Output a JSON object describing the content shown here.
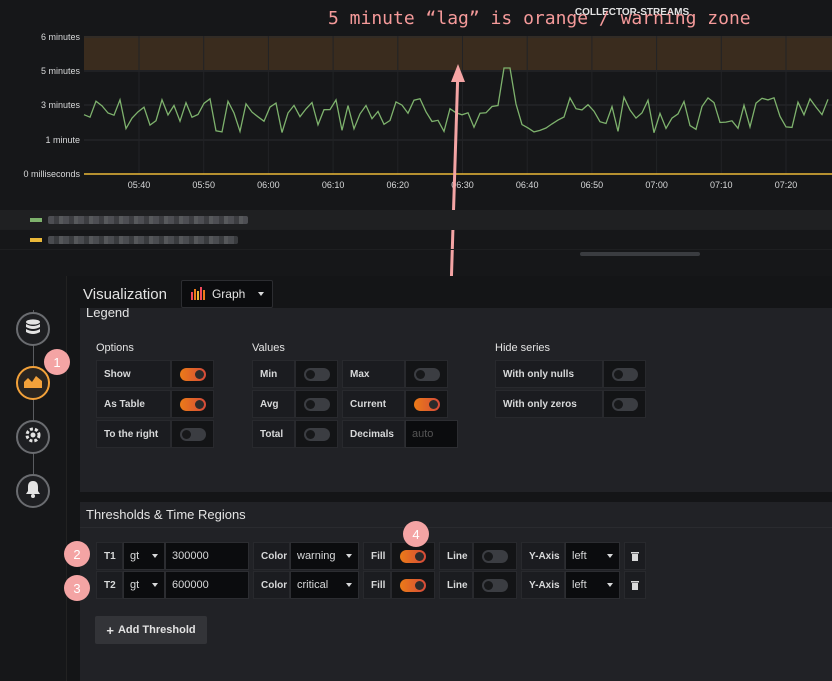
{
  "graph": {
    "title": "COLLECTOR-STREAMS",
    "y_ticks": [
      "6 minutes",
      "5 minutes",
      "3 minutes",
      "1 minute",
      "0 milliseconds"
    ],
    "x_ticks": [
      "05:40",
      "05:50",
      "06:00",
      "06:10",
      "06:20",
      "06:30",
      "06:40",
      "06:50",
      "07:00",
      "07:10",
      "07:20"
    ],
    "line_color": "#7eb26d",
    "threshold_line_color": "#eab839",
    "warning_zone_color": "#3a2c1e"
  },
  "annotation": {
    "note": "5 minute “lag” is orange / warning zone",
    "color": "#f59a9a",
    "markers": [
      "1",
      "2",
      "3",
      "4"
    ]
  },
  "sidebar": {
    "items": [
      {
        "icon": "database-icon"
      },
      {
        "icon": "chart-icon",
        "active": true
      },
      {
        "icon": "cog-icon"
      },
      {
        "icon": "bell-icon"
      }
    ]
  },
  "visualization": {
    "title": "Visualization",
    "selected": "Graph"
  },
  "legend": {
    "title": "Legend",
    "options_title": "Options",
    "values_title": "Values",
    "hide_title": "Hide series",
    "options": [
      {
        "label": "Show",
        "on": true
      },
      {
        "label": "As Table",
        "on": true
      },
      {
        "label": "To the right",
        "on": false
      }
    ],
    "values_col1": [
      {
        "label": "Min",
        "on": false
      },
      {
        "label": "Avg",
        "on": false
      },
      {
        "label": "Total",
        "on": false
      }
    ],
    "values_col2": [
      {
        "label": "Max",
        "on": false
      },
      {
        "label": "Current",
        "on": true
      },
      {
        "label": "Decimals",
        "placeholder": "auto"
      }
    ],
    "hide": [
      {
        "label": "With only nulls",
        "on": false
      },
      {
        "label": "With only zeros",
        "on": false
      }
    ]
  },
  "thresholds": {
    "title": "Thresholds & Time Regions",
    "rows": [
      {
        "id": "T1",
        "op": "gt",
        "value": "300000",
        "color_label": "Color",
        "color": "warning",
        "fill_label": "Fill",
        "fill": true,
        "line_label": "Line",
        "line": false,
        "axis_label": "Y-Axis",
        "axis": "left"
      },
      {
        "id": "T2",
        "op": "gt",
        "value": "600000",
        "color_label": "Color",
        "color": "critical",
        "fill_label": "Fill",
        "fill": true,
        "line_label": "Line",
        "line": false,
        "axis_label": "Y-Axis",
        "axis": "left"
      }
    ],
    "add_label": "Add Threshold"
  }
}
